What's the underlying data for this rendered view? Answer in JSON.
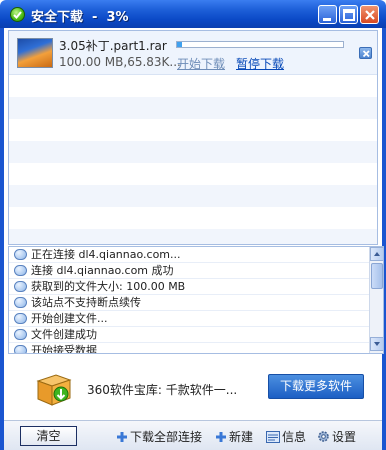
{
  "window": {
    "title": "安全下载  -  3%",
    "controls": {
      "minimize": "minimize",
      "maximize": "maximize",
      "close": "close"
    }
  },
  "download": {
    "file_name": "3.05补丁.part1.rar",
    "status": "100.00 MB,65.83K...",
    "start_link": "开始下载",
    "pause_link": "暂停下载",
    "progress": 0.03,
    "icon": "image-file-icon"
  },
  "log": {
    "lines": [
      "正在连接 dl4.qiannao.com...",
      "连接 dl4.qiannao.com 成功",
      "获取到的文件大小: 100.00 MB",
      "该站点不支持断点续传",
      "开始创建文件...",
      "文件创建成功",
      "开始接受数据"
    ]
  },
  "ad": {
    "text": "360软件宝库: 千款软件一...",
    "button": "下载更多软件",
    "icon": "software-box-icon"
  },
  "toolbar": {
    "clear": "清空",
    "download_all": "下载全部连接",
    "new": "新建",
    "info": "信息",
    "settings": "设置"
  },
  "colors": {
    "titlebar": "#0b49c6",
    "progress": "#3fa0ee",
    "link": "#0648b8",
    "ad_button": "#1c5fc4"
  }
}
